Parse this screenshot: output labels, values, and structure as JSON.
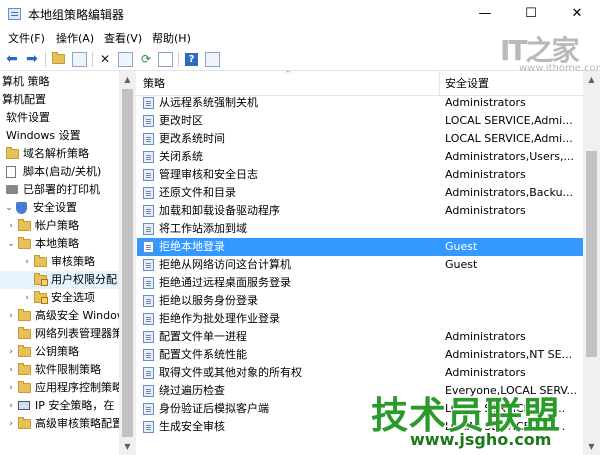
{
  "window": {
    "title": "本地组策略编辑器",
    "controls": {
      "minimize": "—",
      "maximize": "☐",
      "close": "✕"
    }
  },
  "menu": [
    "文件(F)",
    "操作(A)",
    "查看(V)",
    "帮助(H)"
  ],
  "toolbar": {
    "icons": [
      "back-arrow-icon",
      "forward-arrow-icon",
      "up-folder-icon",
      "show-hide-tree-icon",
      "delete-icon",
      "properties-icon",
      "refresh-icon",
      "export-list-icon",
      "help-icon",
      "filter-icon"
    ]
  },
  "watermark": {
    "logo": "IT之家",
    "url": "www.ithome.com",
    "bottom_text": "技术员联盟",
    "bottom_url": "www.jsgho.com"
  },
  "tree": [
    {
      "label": "算机 策略",
      "indent": 0,
      "icon": "none"
    },
    {
      "label": "算机配置",
      "indent": 0,
      "icon": "none"
    },
    {
      "label": "软件设置",
      "indent": 1,
      "icon": "none"
    },
    {
      "label": "Windows 设置",
      "indent": 1,
      "icon": "none"
    },
    {
      "label": "域名解析策略",
      "indent": 1,
      "icon": "folder"
    },
    {
      "label": "脚本(启动/关机)",
      "indent": 1,
      "icon": "doc"
    },
    {
      "label": "已部署的打印机",
      "indent": 1,
      "icon": "printer"
    },
    {
      "label": "安全设置",
      "indent": 1,
      "icon": "shield",
      "expanded": true
    },
    {
      "label": "帐户策略",
      "indent": 2,
      "icon": "folder",
      "collapsed": true
    },
    {
      "label": "本地策略",
      "indent": 2,
      "icon": "folder",
      "expanded": true
    },
    {
      "label": "审核策略",
      "indent": 3,
      "icon": "folder",
      "collapsed": true
    },
    {
      "label": "用户权限分配",
      "indent": 3,
      "icon": "folder-lock",
      "selected": true
    },
    {
      "label": "安全选项",
      "indent": 3,
      "icon": "folder-lock",
      "collapsed": true
    },
    {
      "label": "高级安全 Windows",
      "indent": 2,
      "icon": "folder",
      "collapsed": true
    },
    {
      "label": "网络列表管理器策略",
      "indent": 2,
      "icon": "folder"
    },
    {
      "label": "公钥策略",
      "indent": 2,
      "icon": "folder",
      "collapsed": true
    },
    {
      "label": "软件限制策略",
      "indent": 2,
      "icon": "folder",
      "collapsed": true
    },
    {
      "label": "应用程序控制策略",
      "indent": 2,
      "icon": "folder",
      "collapsed": true
    },
    {
      "label": "IP 安全策略，在",
      "indent": 2,
      "icon": "pc",
      "collapsed": true
    },
    {
      "label": "高级审核策略配置",
      "indent": 2,
      "icon": "folder",
      "collapsed": true
    }
  ],
  "list": {
    "columns": {
      "policy": "策略",
      "setting": "安全设置"
    },
    "rows": [
      {
        "policy": "从远程系统强制关机",
        "setting": "Administrators"
      },
      {
        "policy": "更改时区",
        "setting": "LOCAL SERVICE,Admi..."
      },
      {
        "policy": "更改系统时间",
        "setting": "LOCAL SERVICE,Admi..."
      },
      {
        "policy": "关闭系统",
        "setting": "Administrators,Users,..."
      },
      {
        "policy": "管理审核和安全日志",
        "setting": "Administrators"
      },
      {
        "policy": "还原文件和目录",
        "setting": "Administrators,Backu..."
      },
      {
        "policy": "加载和卸载设备驱动程序",
        "setting": "Administrators"
      },
      {
        "policy": "将工作站添加到域",
        "setting": ""
      },
      {
        "policy": "拒绝本地登录",
        "setting": "Guest",
        "selected": true
      },
      {
        "policy": "拒绝从网络访问这台计算机",
        "setting": "Guest"
      },
      {
        "policy": "拒绝通过远程桌面服务登录",
        "setting": ""
      },
      {
        "policy": "拒绝以服务身份登录",
        "setting": ""
      },
      {
        "policy": "拒绝作为批处理作业登录",
        "setting": ""
      },
      {
        "policy": "配置文件单一进程",
        "setting": "Administrators"
      },
      {
        "policy": "配置文件系统性能",
        "setting": "Administrators,NT SE..."
      },
      {
        "policy": "取得文件或其他对象的所有权",
        "setting": "Administrators"
      },
      {
        "policy": "绕过遍历检查",
        "setting": "Everyone,LOCAL SERV..."
      },
      {
        "policy": "身份验证后模拟客户端",
        "setting": "LOCAL SERVICE,NET..."
      },
      {
        "policy": "生成安全审核",
        "setting": "LOCAL SERVICE,NET..."
      }
    ]
  }
}
